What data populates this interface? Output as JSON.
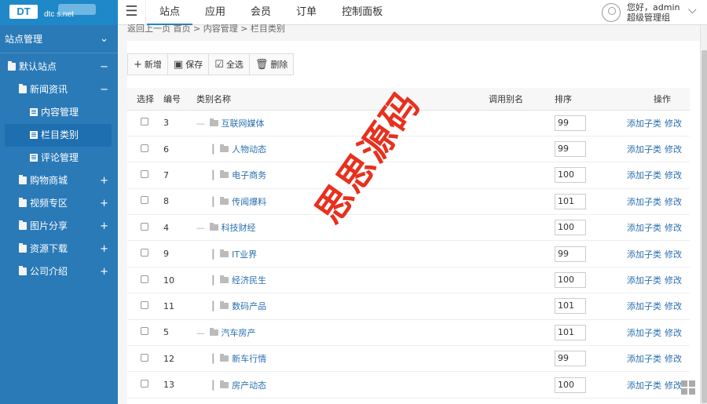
{
  "logo": {
    "badge": "DT",
    "domain": "dtc   s.net"
  },
  "nav": [
    "站点",
    "应用",
    "会员",
    "订单",
    "控制面板"
  ],
  "user": {
    "greeting": "您好，admin",
    "role": "超级管理组"
  },
  "sidebar": {
    "title": "站点管理",
    "items": [
      {
        "label": "默认站点",
        "sign": "−"
      },
      {
        "label": "新闻资讯",
        "sign": "−"
      },
      {
        "label": "内容管理"
      },
      {
        "label": "栏目类别"
      },
      {
        "label": "评论管理"
      },
      {
        "label": "购物商城",
        "sign": "+"
      },
      {
        "label": "视频专区",
        "sign": "+"
      },
      {
        "label": "图片分享",
        "sign": "+"
      },
      {
        "label": "资源下载",
        "sign": "+"
      },
      {
        "label": "公司介绍",
        "sign": "+"
      }
    ]
  },
  "breadcrumb": "返回上一页   首页 > 内容管理 > 栏目类别",
  "toolbar": {
    "add": "新增",
    "save": "保存",
    "select_all": "全选",
    "delete": "删除"
  },
  "table": {
    "headers": {
      "select": "选择",
      "id": "编号",
      "name": "类别名称",
      "alias": "调用别名",
      "sort": "排序",
      "ops": "操作"
    },
    "add_child": "添加子类",
    "edit": "修改",
    "rows": [
      {
        "id": "3",
        "name": "互联网媒体",
        "sort": "99",
        "level": 1
      },
      {
        "id": "6",
        "name": "人物动态",
        "sort": "99",
        "level": 2
      },
      {
        "id": "7",
        "name": "电子商务",
        "sort": "100",
        "level": 2
      },
      {
        "id": "8",
        "name": "传闻爆料",
        "sort": "101",
        "level": 2
      },
      {
        "id": "4",
        "name": "科技财经",
        "sort": "100",
        "level": 1
      },
      {
        "id": "9",
        "name": "IT业界",
        "sort": "99",
        "level": 2
      },
      {
        "id": "10",
        "name": "经济民生",
        "sort": "100",
        "level": 2
      },
      {
        "id": "11",
        "name": "数码产品",
        "sort": "101",
        "level": 2
      },
      {
        "id": "5",
        "name": "汽车房产",
        "sort": "101",
        "level": 1
      },
      {
        "id": "12",
        "name": "新车行情",
        "sort": "99",
        "level": 2
      },
      {
        "id": "13",
        "name": "房产动态",
        "sort": "100",
        "level": 2
      }
    ]
  },
  "watermark": "思思源码"
}
